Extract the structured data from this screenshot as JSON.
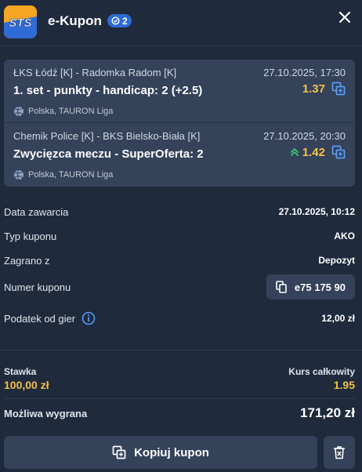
{
  "header": {
    "logo_text": "STS",
    "title": "e-Kupon",
    "bet_count": "2"
  },
  "bets": [
    {
      "teams": "ŁKS Łódź [K] - Radomka Radom [K]",
      "date": "27.10.2025, 17:30",
      "market": "1. set - punkty - handicap: 2 (+2.5)",
      "odds": "1.37",
      "league": "Polska, TAURON Liga",
      "trend": null
    },
    {
      "teams": "Chemik Police [K] - BKS Bielsko-Biała [K]",
      "date": "27.10.2025, 20:30",
      "market": "Zwycięzca meczu - SuperOferta: 2",
      "odds": "1.42",
      "league": "Polska, TAURON Liga",
      "trend": "up"
    }
  ],
  "details": {
    "date_label": "Data zawarcia",
    "date_value": "27.10.2025, 10:12",
    "type_label": "Typ kuponu",
    "type_value": "AKO",
    "played_label": "Zagrano z",
    "played_value": "Depozyt",
    "number_label": "Numer kuponu",
    "number_value": "e75 175 90",
    "tax_label": "Podatek od gier",
    "tax_value": "12,00 zł"
  },
  "summary": {
    "stake_label": "Stawka",
    "stake_value": "100,00 zł",
    "course_label": "Kurs całkowity",
    "course_value": "1.95",
    "win_label": "Możliwa wygrana",
    "win_value": "171,20 zł"
  },
  "actions": {
    "copy_label": "Kopiuj kupon"
  },
  "colors": {
    "background": "#1f2a3c",
    "card": "#34425a",
    "accent_yellow": "#f5c04a",
    "accent_blue": "#2f6bd6",
    "trend_green": "#3ec46d",
    "icon_blue": "#5b9cf5"
  },
  "icons": {
    "close": "close-icon",
    "copy_selection": "copy-selection-icon",
    "volleyball": "volleyball-icon",
    "copy": "copy-icon",
    "info": "info-icon",
    "trash": "trash-icon",
    "badge": "coupon-count-icon"
  }
}
